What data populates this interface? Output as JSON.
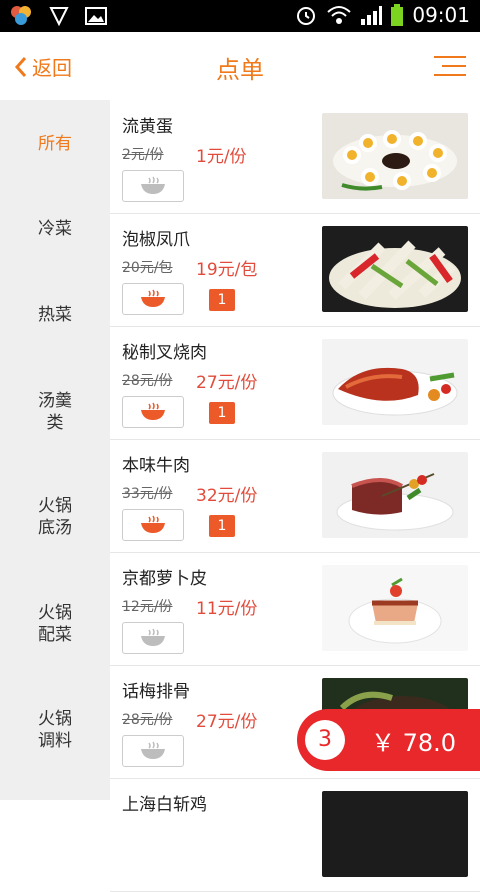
{
  "status_bar": {
    "time": "09:01"
  },
  "header": {
    "back_label": "返回",
    "title": "点单"
  },
  "sidebar": {
    "categories": [
      {
        "label": "所有"
      },
      {
        "label": "冷菜"
      },
      {
        "label": "热菜"
      },
      {
        "label": "汤羹\n类"
      },
      {
        "label": "火锅\n底汤"
      },
      {
        "label": "火锅\n配菜"
      },
      {
        "label": "火锅\n调料"
      }
    ]
  },
  "items": [
    {
      "name": "流黄蛋",
      "old_price": "2元/份",
      "price": "1元/份",
      "qty": ""
    },
    {
      "name": "泡椒凤爪",
      "old_price": "20元/包",
      "price": "19元/包",
      "qty": "1"
    },
    {
      "name": "秘制叉烧肉",
      "old_price": "28元/份",
      "price": "27元/份",
      "qty": "1"
    },
    {
      "name": "本味牛肉",
      "old_price": "33元/份",
      "price": "32元/份",
      "qty": "1"
    },
    {
      "name": "京都萝卜皮",
      "old_price": "12元/份",
      "price": "11元/份",
      "qty": ""
    },
    {
      "name": "话梅排骨",
      "old_price": "28元/份",
      "price": "27元/份",
      "qty": ""
    },
    {
      "name": "上海白斩鸡",
      "old_price": "",
      "price": "",
      "qty": ""
    }
  ],
  "cart": {
    "count": "3",
    "total": "￥ 78.0"
  },
  "colors": {
    "accent": "#f07a1b",
    "price_red": "#e24b3b",
    "cart_red": "#e8282b",
    "qty_orange": "#ec5a2a"
  }
}
